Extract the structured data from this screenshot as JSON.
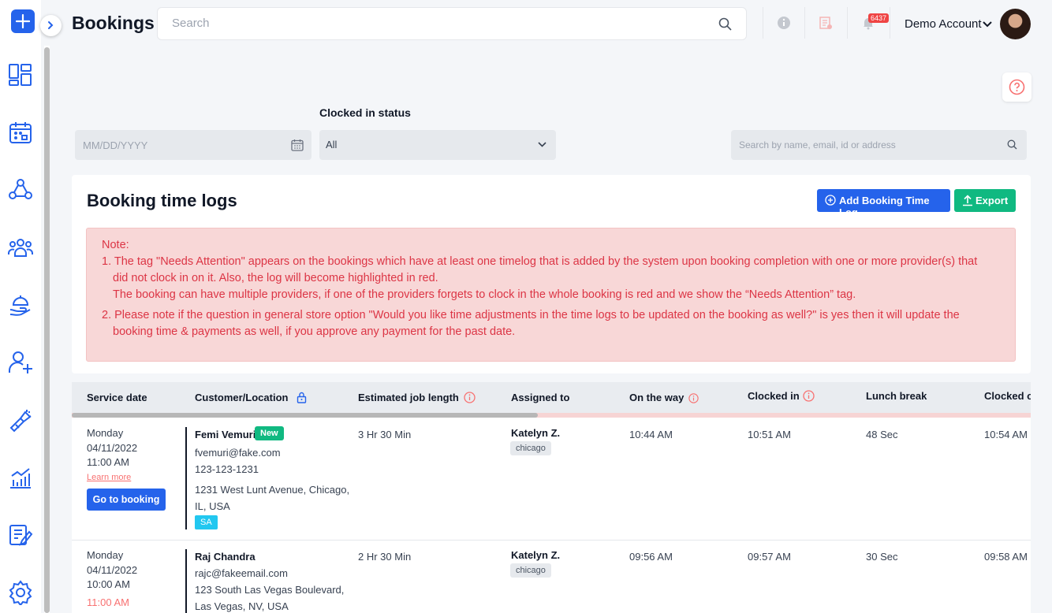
{
  "header": {
    "title": "Bookings",
    "search_placeholder": "Search",
    "notification_count": "6437",
    "account_name": "Demo Account"
  },
  "sidebar": {
    "items": [
      "dashboard-icon",
      "calendar-icon",
      "network-icon",
      "team-icon",
      "service-icon",
      "add-user-icon",
      "marketing-icon",
      "reports-icon",
      "forms-icon",
      "settings-icon"
    ]
  },
  "filters": {
    "date_placeholder": "MM/DD/YYYY",
    "clocked_label": "Clocked in status",
    "clocked_value": "All",
    "search_placeholder": "Search by name, email, id or address"
  },
  "card": {
    "title": "Booking time logs",
    "add_label": "Add Booking Time Log",
    "export_label": "Export",
    "note_title": "Note:",
    "note_lines": [
      "1. The tag \"Needs Attention\" appears on the bookings which have at least one timelog that is added by the system upon booking completion with one or more provider(s) that",
      "did not clock in on it. Also, the log will become highlighted in red.",
      "The booking can have multiple providers, if one of the providers forgets to clock in the whole booking is red and we show the “Needs Attention” tag.",
      "2. Please note if the question in general store option \"Would you like time adjustments in the time logs to be updated on the booking as well?\" is yes then it will update the",
      "booking time & payments as well, if you approve any payment for the past date."
    ]
  },
  "table": {
    "columns": [
      "Service date",
      "Customer/Location",
      "Estimated job length",
      "Assigned to",
      "On the way",
      "Clocked in",
      "Lunch break",
      "Clocked out"
    ],
    "rows": [
      {
        "day": "Monday",
        "date": "04/11/2022",
        "time": "11:00 AM",
        "learn_more": "Learn more",
        "go_label": "Go to booking",
        "name": "Femi Vemuri",
        "new_badge": "New",
        "email": "fvemuri@fake.com",
        "phone": "123-123-1231",
        "address1": "1231 West Lunt Avenue, Chicago,",
        "address2": "IL, USA",
        "tag": "SA",
        "length": "3 Hr 30 Min",
        "assigned": "Katelyn Z.",
        "location_tag": "chicago",
        "on_the_way": "10:44 AM",
        "clocked_in": "10:51 AM",
        "lunch": "48 Sec",
        "clocked_out": "10:54 AM"
      },
      {
        "day": "Monday",
        "date": "04/11/2022",
        "time": "10:00 AM",
        "time_red": "11:00 AM",
        "name": "Raj Chandra",
        "email": "rajc@fakeemail.com",
        "address1": "123 South Las Vegas Boulevard,",
        "address2": "Las Vegas, NV, USA",
        "length": "2 Hr 30 Min",
        "assigned": "Katelyn Z.",
        "location_tag": "chicago",
        "on_the_way": "09:56 AM",
        "clocked_in": "09:57 AM",
        "lunch": "30 Sec",
        "clocked_out": "09:58 AM"
      }
    ]
  },
  "colors": {
    "primary": "#2563eb",
    "success": "#10b981",
    "danger": "#dc3545",
    "note_bg": "#f8d7d7"
  }
}
